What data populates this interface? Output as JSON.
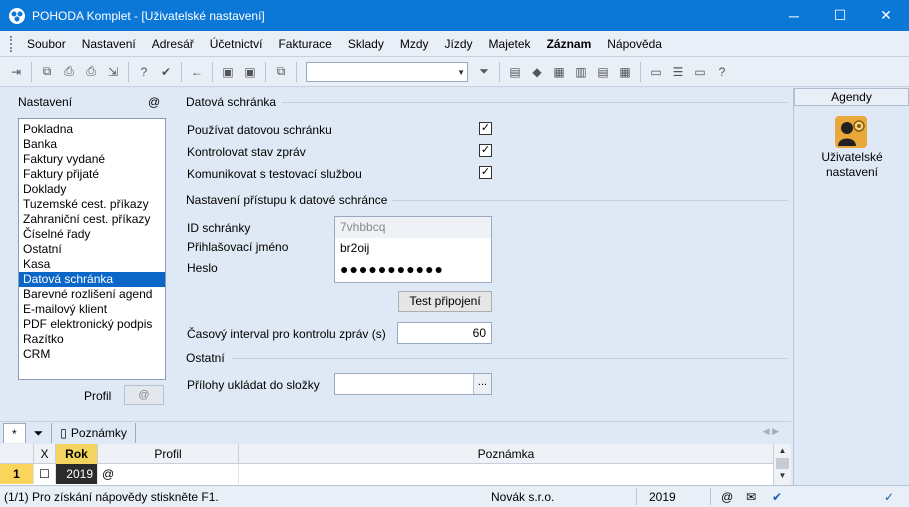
{
  "window": {
    "title": "POHODA Komplet - [Uživatelské nastavení]",
    "controls": [
      "─",
      "☐",
      "✕"
    ]
  },
  "menu": [
    "Soubor",
    "Nastavení",
    "Adresář",
    "Účetnictví",
    "Fakturace",
    "Sklady",
    "Mzdy",
    "Jízdy",
    "Majetek",
    "Záznam",
    "Nápověda"
  ],
  "menu_bold": "Záznam",
  "toolbar": {
    "combo_value": ""
  },
  "left": {
    "title": "Nastavení",
    "at": "@",
    "items": [
      "Pokladna",
      "Banka",
      "Faktury vydané",
      "Faktury přijaté",
      "Doklady",
      "Tuzemské cest. příkazy",
      "Zahraniční cest. příkazy",
      "Číselné řady",
      "Ostatní",
      "Kasa",
      "Datová schránka",
      "Barevné rozlišení agend",
      "E-mailový klient",
      "PDF elektronický podpis",
      "Razítko",
      "CRM"
    ],
    "selected": "Datová schránka",
    "profile_label": "Profil",
    "profile_value": "@"
  },
  "panel": {
    "section1": "Datová schránka",
    "options": [
      {
        "label": "Používat datovou schránku",
        "checked": true
      },
      {
        "label": "Kontrolovat stav zpráv",
        "checked": true
      },
      {
        "label": "Komunikovat s testovací službou",
        "checked": true
      }
    ],
    "section2": "Nastavení přístupu k datové schránce",
    "id_label": "ID schránky",
    "id_value": "7vhbbcq",
    "login_label": "Přihlašovací jméno",
    "login_value": "br2oij",
    "password_label": "Heslo",
    "password_value": "●●●●●●●●●●●",
    "test_button": "Test připojení",
    "interval_label": "Časový interval pro kontrolu zpráv (s)",
    "interval_value": "60",
    "section3": "Ostatní",
    "attachments_label": "Přílohy ukládat do složky",
    "attachments_value": "",
    "browse_button": "..."
  },
  "agendy": {
    "title": "Agendy",
    "item_label": "Uživatelské nastavení"
  },
  "tabs": {
    "star": "*",
    "notes": "Poznámky"
  },
  "grid": {
    "headers": {
      "x": "X",
      "rok": "Rok",
      "profil": "Profil",
      "poznamka": "Poznámka"
    },
    "row": {
      "num": "1",
      "rok": "2019",
      "profil": "@",
      "poznamka": ""
    }
  },
  "status": {
    "help": "(1/1) Pro získání nápovědy stiskněte F1.",
    "company": "Novák s.r.o.",
    "year": "2019",
    "at": "@"
  },
  "colors": {
    "titlebar": "#0b78d7",
    "selection": "#0a66c7",
    "highlight_yellow": "#f2d45f"
  }
}
